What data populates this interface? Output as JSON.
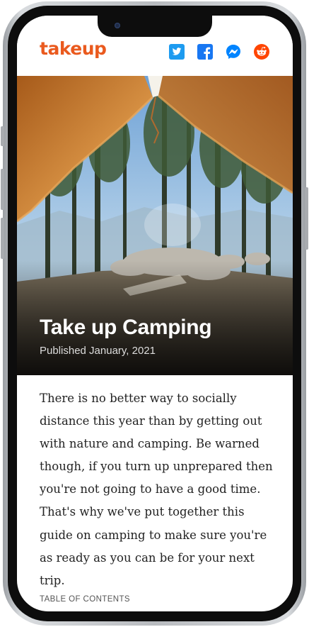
{
  "brand": {
    "name": "takeup",
    "color": "#ea5a1e"
  },
  "share_icons": [
    {
      "name": "twitter-icon",
      "color": "#1d9bf0"
    },
    {
      "name": "facebook-icon",
      "color": "#1877f2"
    },
    {
      "name": "messenger-icon",
      "color": "#0084ff"
    },
    {
      "name": "reddit-icon",
      "color": "#ff4500"
    }
  ],
  "hero": {
    "title": "Take up Camping",
    "published": "Published January, 2021"
  },
  "article": {
    "intro": "There is no better way to socially distance this year than by getting out with nature and camping. Be warned though, if you turn up unprepared then you're not going to have a good time. That's why we've put together this guide on camping to make sure you're as ready as you can be for your next trip."
  },
  "toc": {
    "heading": "TABLE OF CONTENTS"
  }
}
